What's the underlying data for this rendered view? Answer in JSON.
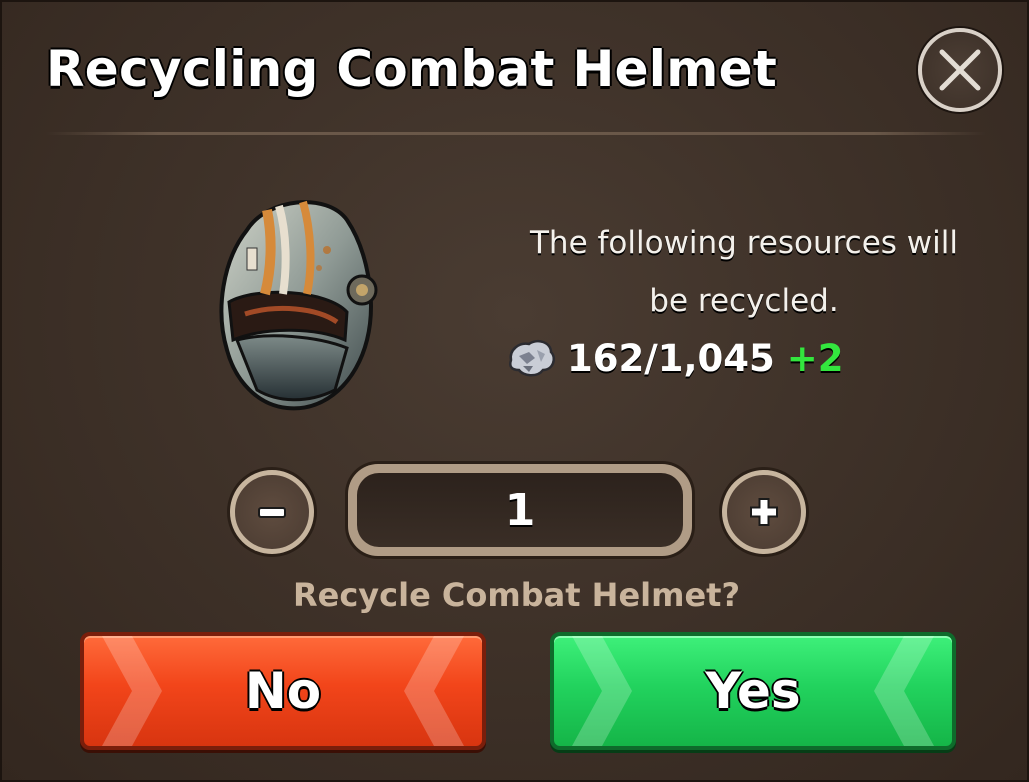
{
  "dialog": {
    "title": "Recycling Combat Helmet",
    "close_icon": "close-icon"
  },
  "item": {
    "name": "Combat Helmet",
    "icon": "helmet-icon"
  },
  "info": {
    "line1": "The following resources will",
    "line2": "be recycled."
  },
  "resource": {
    "icon": "scrap-metal-icon",
    "count": "162/1,045",
    "gain": "+2",
    "gain_color": "#33e63e"
  },
  "quantity": {
    "value": "1",
    "minus_icon": "minus-icon",
    "plus_icon": "plus-icon"
  },
  "prompt": "Recycle Combat Helmet?",
  "buttons": {
    "no_label": "No",
    "yes_label": "Yes",
    "no_color": "#f2451a",
    "yes_color": "#22d35e"
  }
}
